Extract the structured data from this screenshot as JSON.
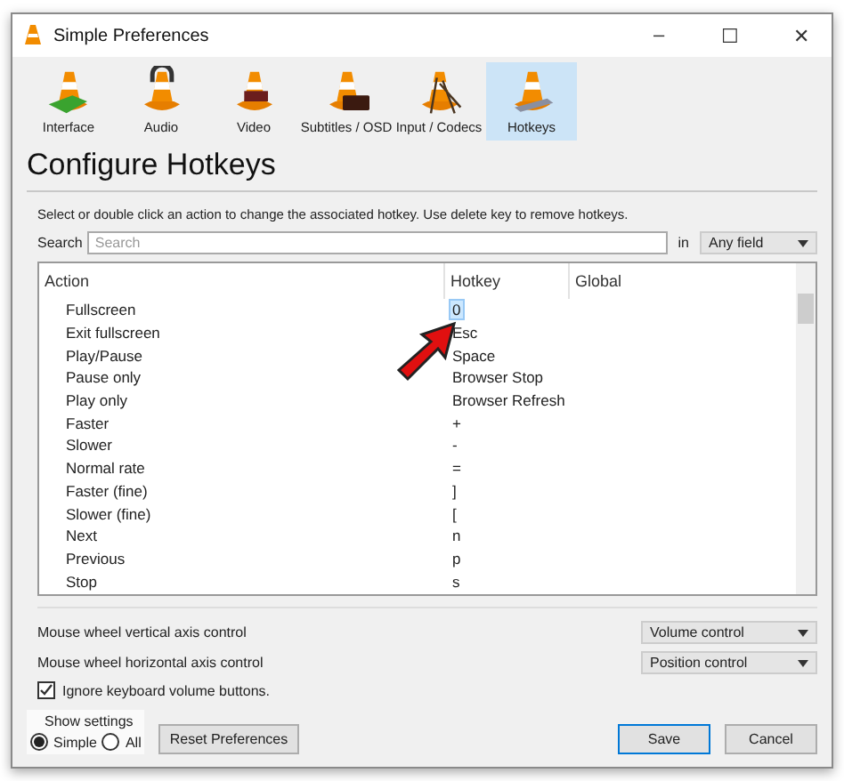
{
  "window": {
    "title": "Simple Preferences",
    "controls": [
      "–",
      "☐",
      "✕"
    ]
  },
  "tabs": [
    {
      "label": "Interface",
      "selected": false,
      "kind": "interface"
    },
    {
      "label": "Audio",
      "selected": false,
      "kind": "audio"
    },
    {
      "label": "Video",
      "selected": false,
      "kind": "video"
    },
    {
      "label": "Subtitles / OSD",
      "selected": false,
      "kind": "subtitles"
    },
    {
      "label": "Input / Codecs",
      "selected": false,
      "kind": "input"
    },
    {
      "label": "Hotkeys",
      "selected": true,
      "kind": "hotkeys"
    }
  ],
  "heading": "Configure Hotkeys",
  "instructions": "Select or double click an action to change the associated hotkey. Use delete key to remove hotkeys.",
  "search": {
    "label": "Search",
    "placeholder": "Search",
    "in_label": "in",
    "field": "Any field"
  },
  "table": {
    "columns": [
      "Action",
      "Hotkey",
      "Global"
    ],
    "rows": [
      {
        "action": "Fullscreen",
        "hotkey": "0",
        "selected": true
      },
      {
        "action": "Exit fullscreen",
        "hotkey": "Esc",
        "selected": false
      },
      {
        "action": "Play/Pause",
        "hotkey": "Space",
        "selected": false
      },
      {
        "action": "Pause only",
        "hotkey": "Browser Stop",
        "selected": false
      },
      {
        "action": "Play only",
        "hotkey": "Browser Refresh",
        "selected": false
      },
      {
        "action": "Faster",
        "hotkey": "+",
        "selected": false
      },
      {
        "action": "Slower",
        "hotkey": "-",
        "selected": false
      },
      {
        "action": "Normal rate",
        "hotkey": "=",
        "selected": false
      },
      {
        "action": "Faster (fine)",
        "hotkey": "]",
        "selected": false
      },
      {
        "action": "Slower (fine)",
        "hotkey": "[",
        "selected": false
      },
      {
        "action": "Next",
        "hotkey": "n",
        "selected": false
      },
      {
        "action": "Previous",
        "hotkey": "p",
        "selected": false
      },
      {
        "action": "Stop",
        "hotkey": "s",
        "selected": false
      }
    ]
  },
  "mouse_settings": [
    {
      "label": "Mouse wheel vertical axis control",
      "value": "Volume control"
    },
    {
      "label": "Mouse wheel horizontal axis control",
      "value": "Position control"
    }
  ],
  "ignore_volume_buttons": {
    "label": "Ignore keyboard volume buttons.",
    "checked": true
  },
  "show_settings": {
    "label": "Show settings",
    "options": [
      {
        "label": "Simple",
        "selected": true
      },
      {
        "label": "All",
        "selected": false
      }
    ]
  },
  "buttons": [
    {
      "label": "Reset Preferences",
      "kind": "reset"
    },
    {
      "label": "Save",
      "kind": "default"
    },
    {
      "label": "Cancel",
      "kind": "normal"
    }
  ]
}
